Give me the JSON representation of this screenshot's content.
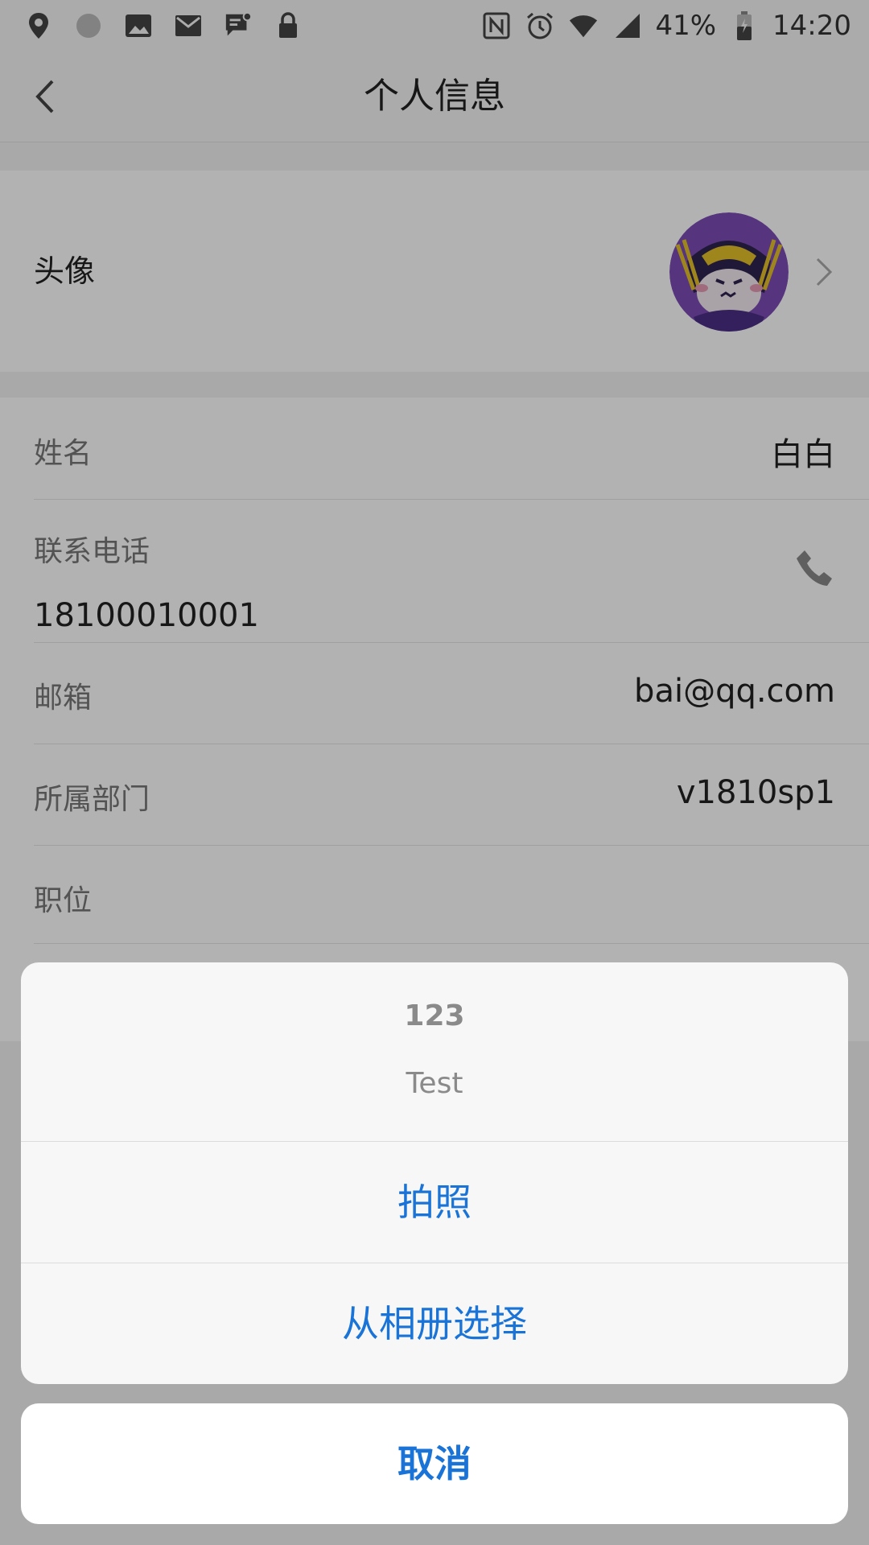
{
  "status_bar": {
    "battery_percent": "41%",
    "time": "14:20",
    "icons": [
      "location-icon",
      "circle-icon",
      "image-icon",
      "mail-icon",
      "message-icon",
      "lock-icon",
      "nfc-icon",
      "alarm-icon",
      "wifi-icon",
      "signal-icon",
      "battery-icon"
    ]
  },
  "header": {
    "title": "个人信息",
    "back_icon": "chevron-left-icon"
  },
  "avatar_row": {
    "label": "头像",
    "chevron_icon": "chevron-right-icon"
  },
  "info": {
    "name_label": "姓名",
    "name_value": "白白",
    "phone_label": "联系电话",
    "phone_value": "18100010001",
    "phone_icon": "phone-icon",
    "email_label": "邮箱",
    "email_value": "bai@qq.com",
    "dept_label": "所属部门",
    "dept_value": "v1810sp1",
    "position_label": "职位",
    "position_value": ""
  },
  "action_sheet": {
    "title": "123",
    "message": "Test",
    "options": [
      {
        "label": "拍照"
      },
      {
        "label": "从相册选择"
      }
    ],
    "cancel_label": "取消",
    "accent_color": "#1a73d6"
  }
}
